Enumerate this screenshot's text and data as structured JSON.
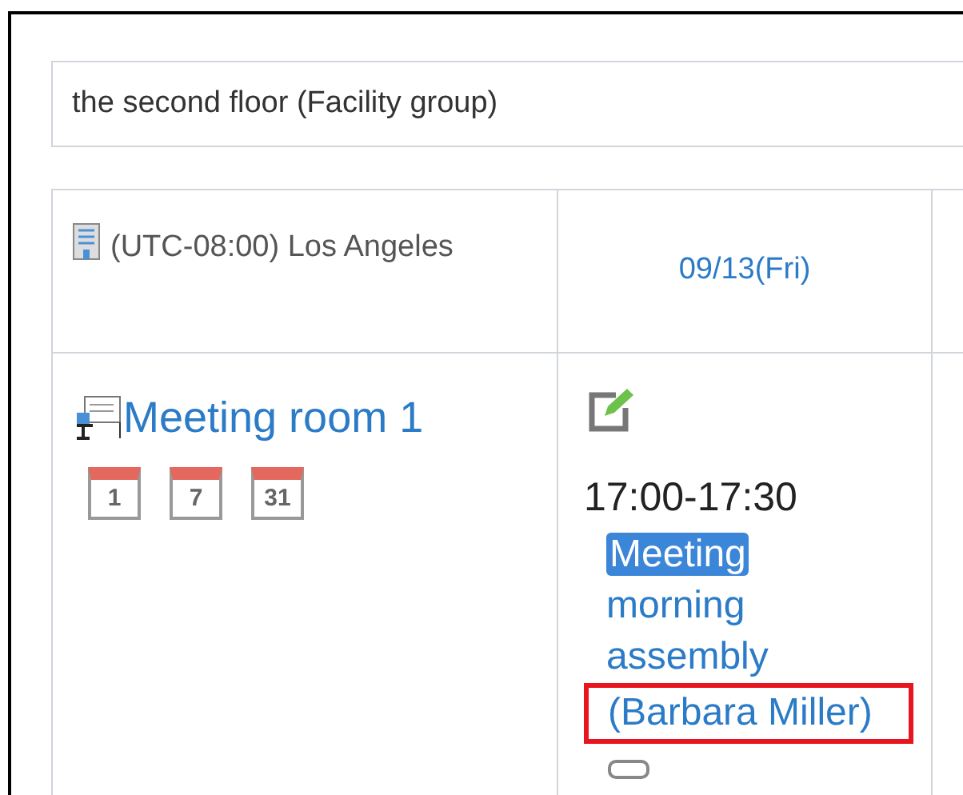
{
  "facility_group": {
    "value": "the second floor (Facility group)"
  },
  "table": {
    "timezone": "(UTC-08:00) Los Angeles",
    "columns": [
      {
        "label": "09/13(Fri)"
      }
    ],
    "rows": [
      {
        "facility": "Meeting room 1",
        "calendar_links": [
          "1",
          "7",
          "31"
        ],
        "events": [
          {
            "time": "17:00-17:30",
            "badge": "Meeting",
            "title": "morning assembly",
            "attendee": "(Barbara Miller)",
            "highlighted": true
          }
        ]
      }
    ]
  }
}
